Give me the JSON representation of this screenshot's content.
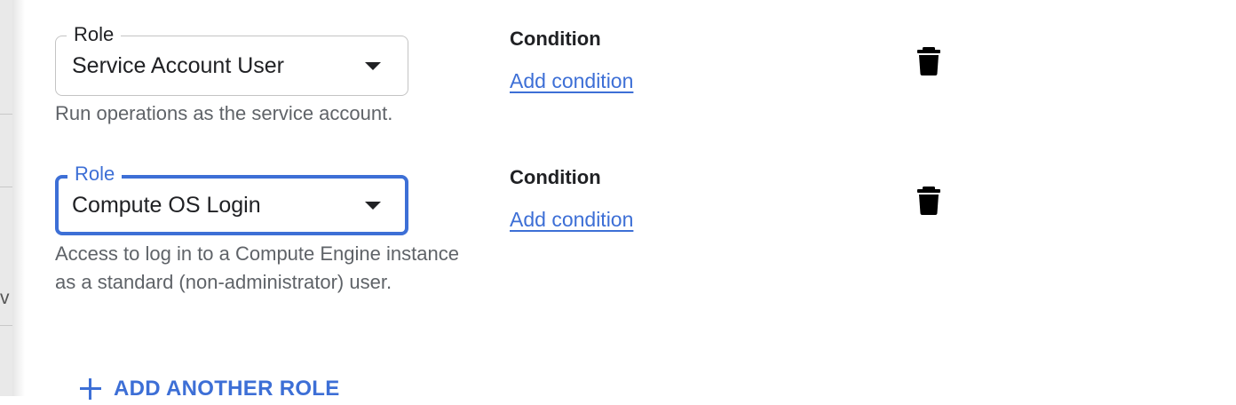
{
  "left_strip": {
    "clip_text": "v"
  },
  "roles": [
    {
      "role_label": "Role",
      "role_value": "Service Account User",
      "description": "Run operations as the service account.",
      "condition_label": "Condition",
      "condition_link": "Add condition",
      "focused": false
    },
    {
      "role_label": "Role",
      "role_value": "Compute OS Login",
      "description": "Access to log in to a Compute Engine instance as a standard (non-administrator) user.",
      "condition_label": "Condition",
      "condition_link": "Add condition",
      "focused": true
    }
  ],
  "add_another_role": {
    "label": "ADD ANOTHER ROLE",
    "icon": "plus-icon"
  },
  "colors": {
    "accent": "#3d6fd6",
    "text_primary": "#202124",
    "text_secondary": "#5f6368",
    "border": "#c4c4c4"
  },
  "icons": {
    "delete": "trash-icon",
    "dropdown": "caret-down-icon"
  }
}
